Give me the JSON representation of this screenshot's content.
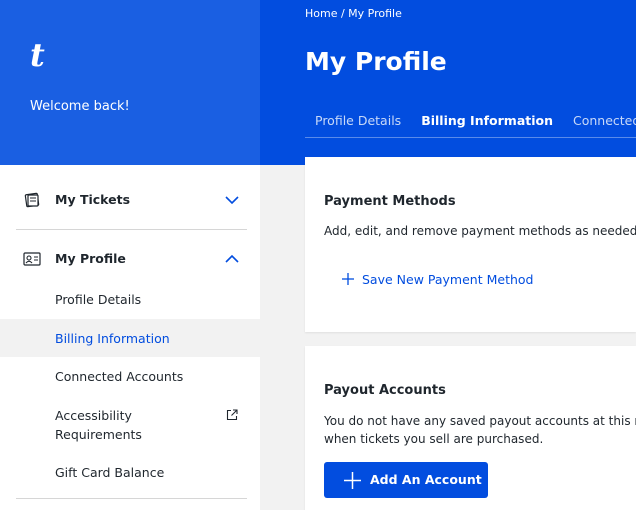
{
  "brand": {
    "logo_text": "t",
    "welcome_text": "Welcome back!"
  },
  "header": {
    "breadcrumb": "Home / My Profile",
    "title": "My Profile",
    "tabs": [
      {
        "label": "Profile Details",
        "active": false
      },
      {
        "label": "Billing Information",
        "active": true
      },
      {
        "label": "Connected Accounts",
        "active": false
      }
    ]
  },
  "sidebar": {
    "tickets": {
      "label": "My Tickets",
      "icon": "tickets-icon",
      "expanded": false
    },
    "profile": {
      "label": "My Profile",
      "icon": "profile-card-icon",
      "expanded": true
    },
    "sub_items": [
      {
        "label": "Profile Details",
        "active": false
      },
      {
        "label": "Billing Information",
        "active": true
      },
      {
        "label": "Connected Accounts",
        "active": false
      },
      {
        "label": "Accessibility\nRequirements",
        "active": false,
        "external": true
      },
      {
        "label": "Gift Card Balance",
        "active": false
      }
    ]
  },
  "payment": {
    "title": "Payment Methods",
    "description": "Add, edit, and remove payment methods as needed.",
    "save_label": "Save New Payment Method"
  },
  "payout": {
    "title": "Payout Accounts",
    "description_1": "You do not have any saved payout accounts at this m",
    "description_2": "when tickets you sell are purchased.",
    "add_label": "Add An Account"
  },
  "colors": {
    "brand_blue": "#024ddf",
    "sidebar_blue": "#1a5fe2",
    "active_row": "#f2f2f2"
  }
}
